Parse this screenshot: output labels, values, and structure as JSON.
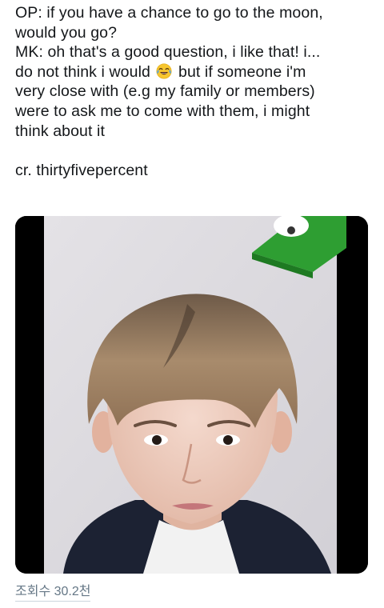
{
  "tweet": {
    "lines": [
      "OP: if you have a chance to go to the moon,",
      "would you go?",
      "MK: oh that's a good question, i like that! i...",
      "do not think i would",
      " but if someone i'm",
      "very close with (e.g my family or members)",
      "were to ask me to come with them, i might",
      "think about it"
    ],
    "credit": "cr. thirtyfivepercent",
    "emoji": "face-with-tears-of-joy-icon"
  },
  "media": {
    "type": "video-thumbnail",
    "description_icon": "person-portrait-icon"
  },
  "footer": {
    "views": "조회수 30.2천"
  },
  "colors": {
    "text": "#14171a",
    "muted": "#657786",
    "background": "#ffffff",
    "sticker_green": "#3db83d"
  }
}
